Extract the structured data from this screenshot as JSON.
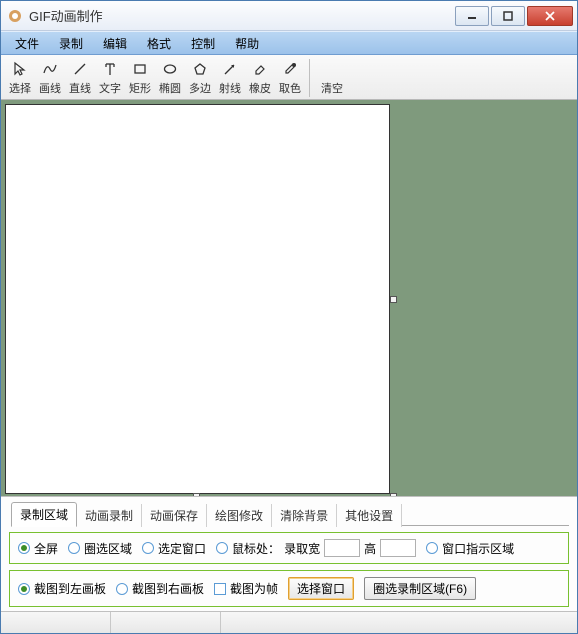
{
  "window": {
    "title": "GIF动画制作"
  },
  "menu": {
    "items": [
      "文件",
      "录制",
      "编辑",
      "格式",
      "控制",
      "帮助"
    ]
  },
  "toolbar": {
    "tools": [
      {
        "icon": "cursor",
        "label": "选择"
      },
      {
        "icon": "curve",
        "label": "画线"
      },
      {
        "icon": "line",
        "label": "直线"
      },
      {
        "icon": "text",
        "label": "文字"
      },
      {
        "icon": "rect",
        "label": "矩形"
      },
      {
        "icon": "ellipse",
        "label": "椭圆"
      },
      {
        "icon": "polygon",
        "label": "多边"
      },
      {
        "icon": "ray",
        "label": "射线"
      },
      {
        "icon": "eraser",
        "label": "橡皮"
      },
      {
        "icon": "dropper",
        "label": "取色"
      }
    ],
    "clear_label": "清空"
  },
  "tabs": {
    "items": [
      "录制区域",
      "动画录制",
      "动画保存",
      "绘图修改",
      "清除背景",
      "其他设置"
    ],
    "active_index": 0
  },
  "row1": {
    "fullscreen": "全屏",
    "select_area": "圈选区域",
    "select_window": "选定窗口",
    "mouse_pos": "鼠标处：",
    "record_width": "录取宽",
    "height": "高",
    "window_hint": "窗口指示区域"
  },
  "row2": {
    "to_left": "截图到左画板",
    "to_right": "截图到右画板",
    "as_frame": "截图为帧",
    "select_window_btn": "选择窗口",
    "circle_record": "圈选录制区域(F6)"
  }
}
